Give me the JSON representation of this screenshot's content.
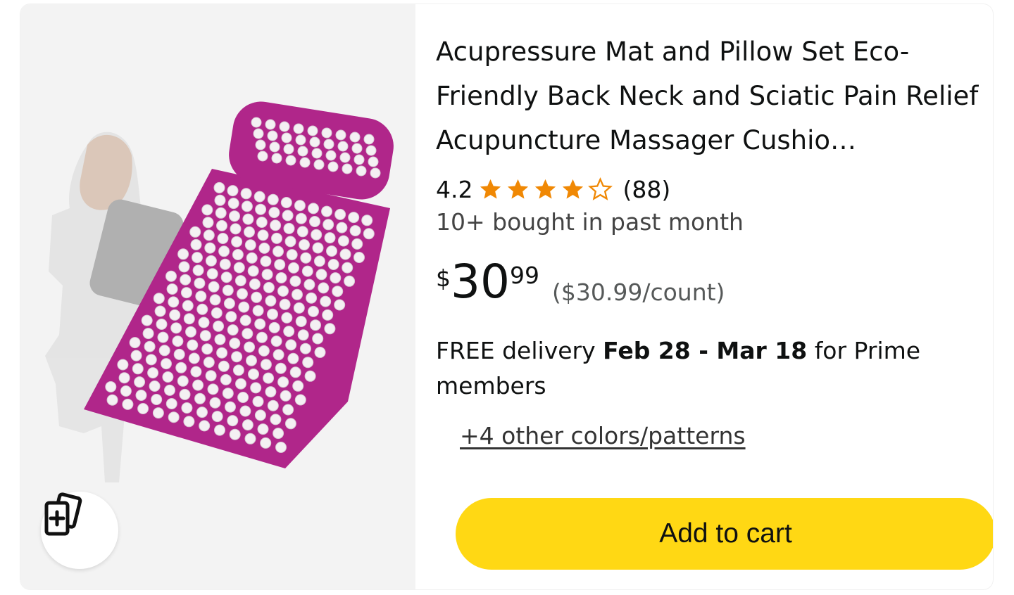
{
  "product": {
    "title": "Acupressure Mat and Pillow Set Eco-Friendly Back Neck and Sciatic Pain Relief Acupuncture Massager Cushio…",
    "rating_value": "4.2",
    "rating_stars": 4.2,
    "review_count": "(88)",
    "bought_text": "10+ bought in past month",
    "price": {
      "currency": "$",
      "whole": "30",
      "fraction": "99",
      "unit_price": "($30.99/count)"
    },
    "delivery": {
      "prefix": "FREE delivery ",
      "dates": "Feb 28 - Mar 18",
      "suffix": " for Prime members"
    },
    "colors_link": "+4 other colors/patterns",
    "add_to_cart": "Add to cart",
    "image_icon": "acupressure-mat-image",
    "compare_icon": "add-to-compare-icon"
  },
  "colors": {
    "accent_button": "#ffd814",
    "star": "#f08804",
    "mat": "#b0268a"
  }
}
